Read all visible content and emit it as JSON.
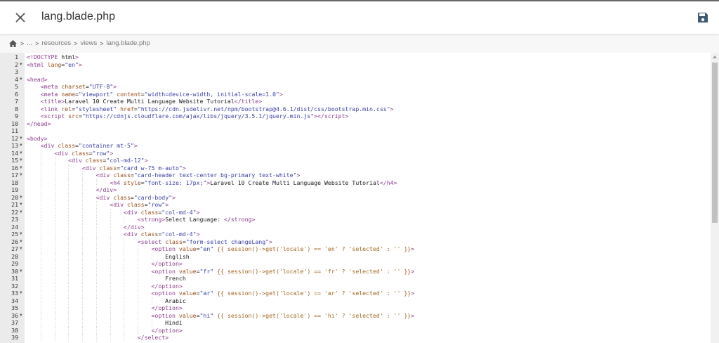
{
  "header": {
    "title": "lang.blade.php",
    "close_icon": "close-icon",
    "save_icon": "save-icon",
    "save_color": "#3f5a73"
  },
  "breadcrumb": {
    "home_icon": "home-icon",
    "items": [
      "...",
      "resources",
      "views",
      "lang.blade.php"
    ]
  },
  "editor": {
    "fold_lines": [
      2,
      4,
      12,
      13,
      14,
      15,
      16,
      17,
      20,
      21,
      22,
      25,
      26,
      27,
      30,
      33,
      36
    ],
    "lines": [
      "<!DOCTYPE html>",
      "<html lang=\"en\">",
      "",
      "<head>",
      "    <meta charset=\"UTF-8\">",
      "    <meta name=\"viewport\" content=\"width=device-width, initial-scale=1.0\">",
      "    <title>Laravel 10 Create Multi Language Website Tutorial</title>",
      "    <link rel=\"stylesheet\" href=\"https://cdn.jsdelivr.net/npm/bootstrap@4.6.1/dist/css/bootstrap.min.css\">",
      "    <script src=\"https://cdnjs.cloudflare.com/ajax/libs/jquery/3.5.1/jquery.min.js\"></script>",
      "</head>",
      "",
      "<body>",
      "    <div class=\"container mt-5\">",
      "        <div class=\"row\">",
      "            <div class=\"col-md-12\">",
      "                <div class=\"card w-75 m-auto\">",
      "                    <div class=\"card-header text-center bg-primary text-white\">",
      "                        <h4 style=\"font-size: 17px;\">Laravel 10 Create Multi Language Website Tutorial</h4>",
      "                    </div>",
      "                    <div class=\"card-body\">",
      "                        <div class=\"row\">",
      "                            <div class=\"col-md-4\">",
      "                                <strong>Select Language: </strong>",
      "                            </div>",
      "                            <div class=\"col-md-4\">",
      "                                <select class=\"form-select changeLang\">",
      "                                    <option value=\"en\" {{ session()->get('locale') == 'en' ? 'selected' : '' }}>",
      "                                        English",
      "                                    </option>",
      "                                    <option value=\"fr\" {{ session()->get('locale') == 'fr' ? 'selected' : '' }}>",
      "                                        French",
      "                                    </option>",
      "                                    <option value=\"ar\" {{ session()->get('locale') == 'ar' ? 'selected' : '' }}>",
      "                                        Arabic",
      "                                    </option>",
      "                                    <option value=\"hi\" {{ session()->get('locale') == 'hi' ? 'selected' : '' }}>",
      "                                        Hindi",
      "                                    </option>",
      "                                </select>"
    ]
  }
}
